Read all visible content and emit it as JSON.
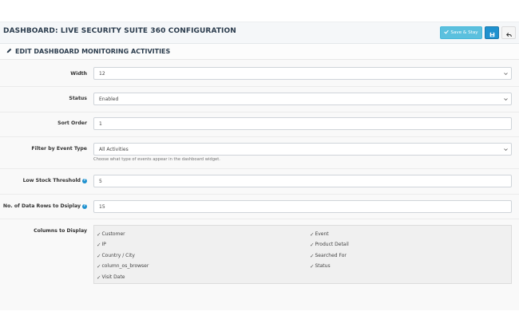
{
  "header": {
    "title": "DASHBOARD: LIVE SECURITY SUITE 360 CONFIGURATION",
    "save_stay_label": "Save & Stay"
  },
  "panel": {
    "title": "EDIT DASHBOARD MONITORING ACTIVITIES"
  },
  "form": {
    "width": {
      "label": "Width",
      "value": "12"
    },
    "status": {
      "label": "Status",
      "value": "Enabled"
    },
    "sort_order": {
      "label": "Sort Order",
      "value": "1"
    },
    "filter": {
      "label": "Filter by Event Type",
      "value": "All Activities",
      "help": "Choose what type of events appear in the dashboard widget."
    },
    "low_stock": {
      "label": "Low Stock Threshold",
      "value": "5"
    },
    "rows": {
      "label": "No. of Data Rows to Dsiplay",
      "value": "15"
    },
    "columns": {
      "label": "Columns to Display",
      "left": [
        "Customer",
        "IP",
        "Country / City",
        "column_os_browser",
        "Visit Date"
      ],
      "right": [
        "Event",
        "Product Detail",
        "Searched For",
        "Status"
      ]
    }
  },
  "colors": {
    "accent": "#1e91cf",
    "save_stay": "#5bc0de",
    "title": "#2b3c4d"
  }
}
